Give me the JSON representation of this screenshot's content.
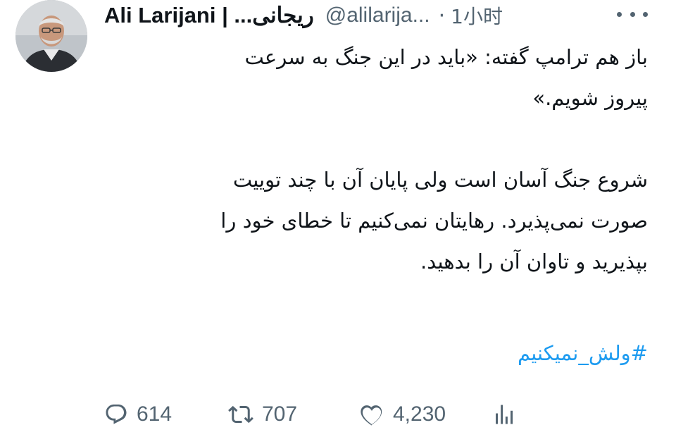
{
  "tweet": {
    "author": {
      "display_name": "Ali Larijani | ...ریجانی",
      "handle": "@alilarija...",
      "separator": "·",
      "time": "1小时"
    },
    "text": {
      "para1": "باز هم ترامپ گفته: «باید در این جنگ به سرعت\nپیروز شویم.»",
      "para2": "شروع جنگ آسان است ولی پایان آن با چند توییت\nصورت نمی‌پذیرد. رهایتان نمی‌کنیم تا خطای خود را\nبپذیرید و تاوان آن را بدهید."
    },
    "hashtag": "#ولش_نمیکنیم",
    "stats": {
      "replies": "614",
      "retweets": "707",
      "likes": "4,230"
    },
    "icons": {
      "reply": "reply-icon",
      "retweet": "retweet-icon",
      "like": "like-icon",
      "views": "views-icon",
      "more": "more-icon"
    },
    "colors": {
      "text": "#0f1419",
      "secondary": "#536471",
      "link": "#1d9bf0"
    }
  }
}
